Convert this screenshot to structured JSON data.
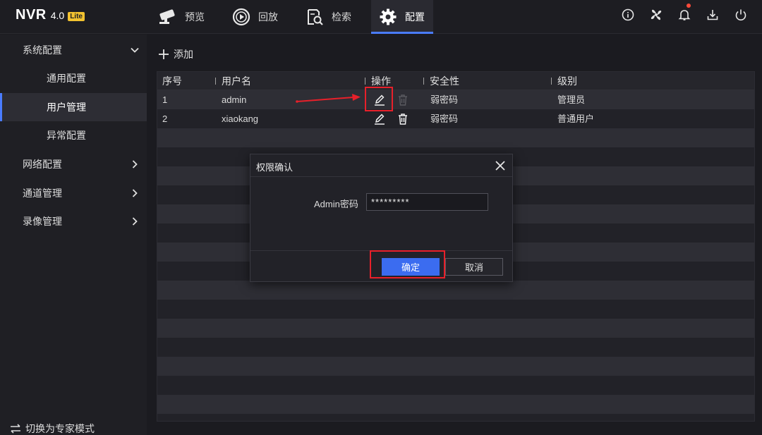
{
  "app": {
    "name": "NVR",
    "version": "4.0",
    "badge": "Lite"
  },
  "nav": {
    "tabs": [
      {
        "label": "预览",
        "icon": "camera-icon"
      },
      {
        "label": "回放",
        "icon": "playback-icon"
      },
      {
        "label": "检索",
        "icon": "search-document-icon"
      },
      {
        "label": "配置",
        "icon": "gear-icon",
        "active": true
      }
    ]
  },
  "top_icons": [
    "info-icon",
    "fan-icon",
    "bell-icon",
    "download-icon",
    "power-icon"
  ],
  "sidebar": {
    "groups": [
      {
        "label": "系统配置",
        "expanded": true
      },
      {
        "label": "网络配置"
      },
      {
        "label": "通道管理"
      },
      {
        "label": "录像管理"
      }
    ],
    "sub_items": [
      {
        "label": "通用配置"
      },
      {
        "label": "用户管理",
        "active": true
      },
      {
        "label": "异常配置"
      }
    ],
    "bottom": "切换为专家模式"
  },
  "toolbar": {
    "add_label": "添加"
  },
  "table": {
    "columns": [
      "序号",
      "用户名",
      "操作",
      "安全性",
      "级别"
    ],
    "rows": [
      {
        "index": "1",
        "username": "admin",
        "security": "弱密码",
        "level": "管理员"
      },
      {
        "index": "2",
        "username": "xiaokang",
        "security": "弱密码",
        "level": "普通用户"
      }
    ]
  },
  "dialog": {
    "title": "权限确认",
    "field_label": "Admin密码",
    "field_value": "*********",
    "ok_label": "确定",
    "cancel_label": "取消"
  },
  "colors": {
    "accent": "#4a7cff",
    "highlight": "#e8202a",
    "badge": "#f2c230"
  }
}
